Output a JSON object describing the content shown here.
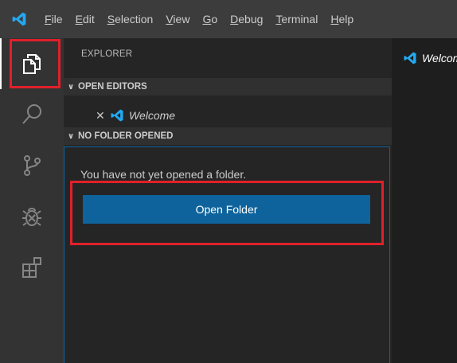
{
  "menubar": {
    "logo_icon": "vscode-logo-icon",
    "items": [
      {
        "label": "File",
        "mnemonic": "F"
      },
      {
        "label": "Edit",
        "mnemonic": "E"
      },
      {
        "label": "Selection",
        "mnemonic": "S"
      },
      {
        "label": "View",
        "mnemonic": "V"
      },
      {
        "label": "Go",
        "mnemonic": "G"
      },
      {
        "label": "Debug",
        "mnemonic": "D"
      },
      {
        "label": "Terminal",
        "mnemonic": "T"
      },
      {
        "label": "Help",
        "mnemonic": "H"
      }
    ]
  },
  "activitybar": {
    "items": [
      "explorer-icon",
      "search-icon",
      "source-control-icon",
      "debug-icon",
      "extensions-icon"
    ]
  },
  "sidebar": {
    "title": "EXPLORER",
    "open_editors_label": "OPEN EDITORS",
    "open_editors": [
      {
        "name": "Welcome"
      }
    ],
    "no_folder_label": "NO FOLDER OPENED",
    "no_folder_message": "You have not yet opened a folder.",
    "open_folder_button": "Open Folder"
  },
  "editor": {
    "tab_label": "Welcome"
  },
  "colors": {
    "accent": "#0e639c",
    "highlight": "#e0202a",
    "vscode_blue": "#23a9f2"
  }
}
